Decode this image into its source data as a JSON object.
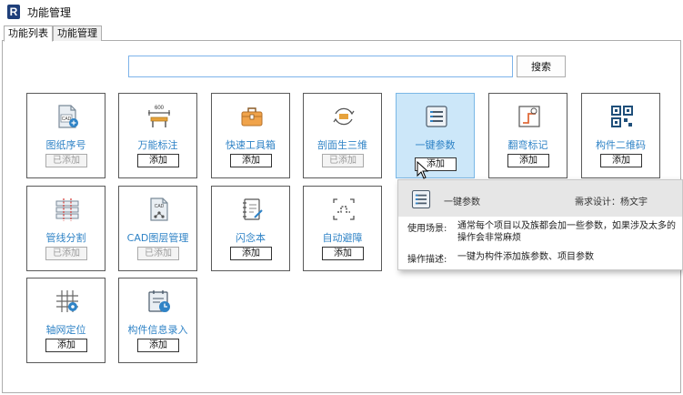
{
  "window": {
    "logo": "R",
    "title": "功能管理"
  },
  "tabs": [
    {
      "label": "功能列表"
    },
    {
      "label": "功能管理"
    }
  ],
  "search": {
    "value": "",
    "placeholder": "",
    "button_label": "搜索"
  },
  "cards": [
    {
      "label": "图纸序号",
      "button": "已添加",
      "icon": "cad-drawing-icon"
    },
    {
      "label": "万能标注",
      "button": "添加",
      "icon": "dimension-icon",
      "icon_text": "600"
    },
    {
      "label": "快速工具箱",
      "button": "添加",
      "icon": "toolbox-icon"
    },
    {
      "label": "剖面生三维",
      "button": "已添加",
      "icon": "section-3d-icon"
    },
    {
      "label": "一键参数",
      "button": "添加",
      "icon": "parameter-list-icon"
    },
    {
      "label": "翻弯标记",
      "button": "添加",
      "icon": "bend-mark-icon"
    },
    {
      "label": "构件二维码",
      "button": "添加",
      "icon": "qr-code-icon"
    },
    {
      "label": "管线分割",
      "button": "已添加",
      "icon": "pipe-split-icon"
    },
    {
      "label": "CAD图层管理",
      "button": "已添加",
      "icon": "cad-layer-icon",
      "icon_text": "CAD"
    },
    {
      "label": "闪念本",
      "button": "添加",
      "icon": "notebook-icon"
    },
    {
      "label": "自动避障",
      "button": "添加",
      "icon": "auto-avoid-icon"
    },
    {
      "label": "轴网定位",
      "button": "添加",
      "icon": "grid-locate-icon"
    },
    {
      "label": "构件信息录入",
      "button": "添加",
      "icon": "info-entry-icon"
    }
  ],
  "tooltip": {
    "name": "一键参数",
    "designer": "需求设计：杨文宇",
    "usage_label": "使用场景:",
    "usage_lines": [
      "通常每个项目以及族都会加一些参数，如果涉及太多的参数",
      "操作会非常麻烦"
    ],
    "desc_label": "操作描述:",
    "desc": "一键为构件添加族参数、项目参数"
  },
  "colors": {
    "accent": "#2f83c6",
    "highlight": "#cce7f9",
    "logo": "#1f3f7a",
    "disabled_text": "#9a9a9a"
  }
}
